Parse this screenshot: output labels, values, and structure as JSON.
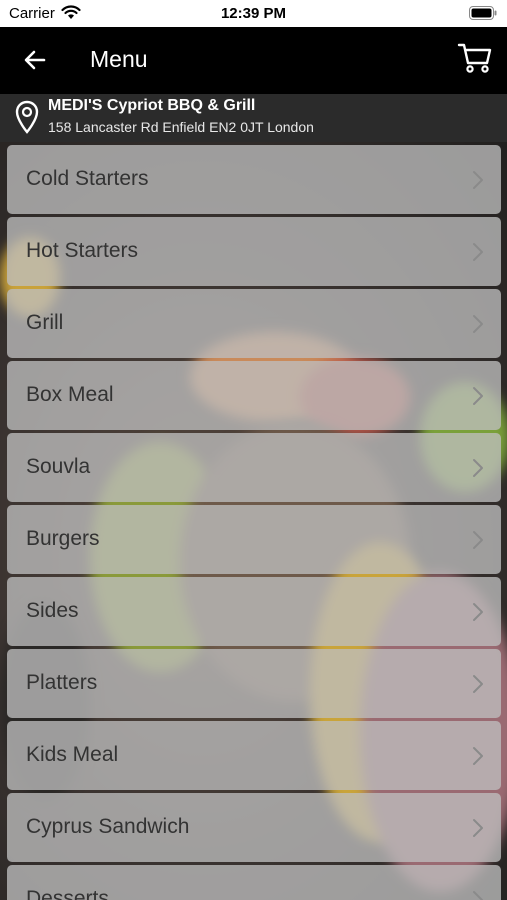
{
  "status": {
    "carrier": "Carrier",
    "time": "12:39 PM"
  },
  "nav": {
    "title": "Menu"
  },
  "restaurant": {
    "name": "MEDI'S Cypriot BBQ & Grill",
    "address": "158 Lancaster Rd Enfield EN2 0JT London"
  },
  "menu": {
    "items": [
      {
        "label": "Cold Starters"
      },
      {
        "label": "Hot Starters"
      },
      {
        "label": "Grill"
      },
      {
        "label": "Box Meal"
      },
      {
        "label": "Souvla"
      },
      {
        "label": "Burgers"
      },
      {
        "label": "Sides"
      },
      {
        "label": "Platters"
      },
      {
        "label": "Kids Meal"
      },
      {
        "label": "Cyprus Sandwich"
      },
      {
        "label": "Desserts"
      }
    ]
  },
  "colors": {
    "nav_bg": "#000000",
    "info_bg": "#2b2b2b",
    "item_bg": "#bebebe",
    "item_text": "#333333"
  },
  "icons": [
    "wifi-icon",
    "battery-icon",
    "back-arrow-icon",
    "cart-icon",
    "location-pin-icon",
    "chevron-right-icon"
  ]
}
